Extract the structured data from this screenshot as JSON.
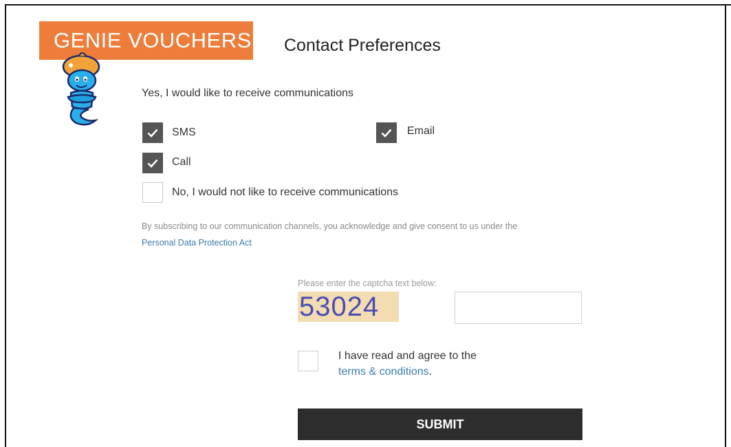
{
  "brand": {
    "logo_text": "GENIE VOUCHERS",
    "logo_color": "#ee7d3b",
    "mascot_icon": "genie-mascot-icon"
  },
  "page": {
    "title": "Contact Preferences"
  },
  "preferences": {
    "intro": "Yes, I would like to receive communications",
    "options": [
      {
        "label": "SMS",
        "checked": true
      },
      {
        "label": "Email",
        "checked": true
      },
      {
        "label": "Call",
        "checked": true
      }
    ],
    "opt_out": {
      "label": "No, I would not like to receive communications",
      "checked": false
    }
  },
  "consent": {
    "text": "By subscribing to our communication channels, you acknowledge and give consent to us under the",
    "link_text": "Personal Data Protection Act"
  },
  "captcha": {
    "label": "Please enter the captcha text below:",
    "code": "53024",
    "input_value": ""
  },
  "terms": {
    "text": "I have read and agree to the",
    "link_text": "terms & conditions",
    "suffix": ".",
    "checked": false
  },
  "submit": {
    "label": "SUBMIT",
    "color": "#2d2d2d"
  },
  "colors": {
    "link": "#3a7cae",
    "checkbox_checked": "#555555"
  }
}
